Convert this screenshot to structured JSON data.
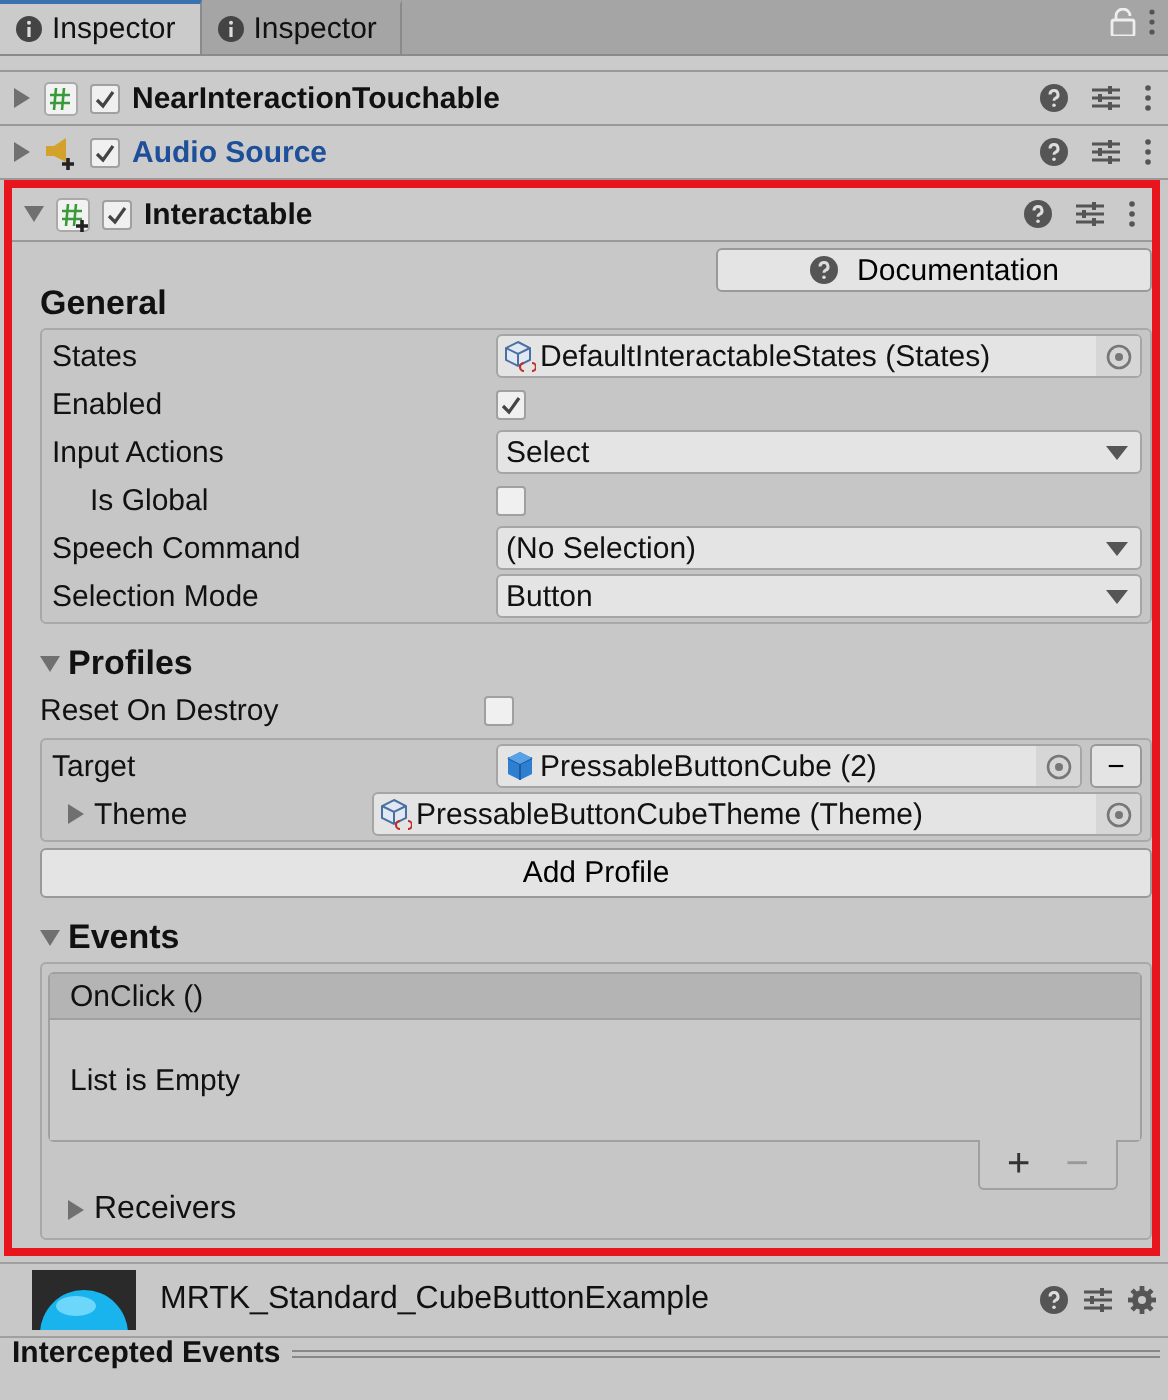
{
  "tabs": [
    {
      "label": "Inspector",
      "selected": true
    },
    {
      "label": "Inspector",
      "selected": false
    }
  ],
  "components": [
    {
      "name": "NearInteractionTouchable",
      "kind": "script",
      "enabled": true,
      "expanded": false,
      "highlight": false
    },
    {
      "name": "Audio Source",
      "kind": "audio",
      "enabled": true,
      "expanded": false,
      "highlight": false
    },
    {
      "name": "Interactable",
      "kind": "script-plus",
      "enabled": true,
      "expanded": true,
      "highlight": true
    }
  ],
  "interactable": {
    "documentation_button": "Documentation",
    "general": {
      "title": "General",
      "fields": [
        {
          "label": "States",
          "kind": "object",
          "value": "DefaultInteractableStates (States)"
        },
        {
          "label": "Enabled",
          "kind": "checkbox",
          "checked": true
        },
        {
          "label": "Input Actions",
          "kind": "dropdown",
          "value": "Select",
          "children": [
            {
              "label": "Is Global",
              "kind": "checkbox",
              "checked": false
            }
          ]
        },
        {
          "label": "Speech Command",
          "kind": "dropdown",
          "value": "(No Selection)"
        },
        {
          "label": "Selection Mode",
          "kind": "dropdown",
          "value": "Button"
        }
      ]
    },
    "profiles": {
      "title": "Profiles",
      "expanded": true,
      "reset_on_destroy": {
        "label": "Reset On Destroy",
        "checked": false
      },
      "target": {
        "label": "Target",
        "value": "PressableButtonCube (2)",
        "remove_button": "−"
      },
      "theme": {
        "label": "Theme",
        "value": "PressableButtonCubeTheme (Theme)",
        "expanded": false
      },
      "add_button": "Add Profile"
    },
    "events": {
      "title": "Events",
      "expanded": true,
      "event_name": "OnClick ()",
      "empty_text": "List is Empty",
      "add_button": "+",
      "remove_button": "−",
      "receivers": {
        "label": "Receivers",
        "expanded": false
      }
    }
  },
  "material": {
    "name": "MRTK_Standard_CubeButtonExample"
  },
  "next_section": {
    "title": "Intercepted Events"
  }
}
